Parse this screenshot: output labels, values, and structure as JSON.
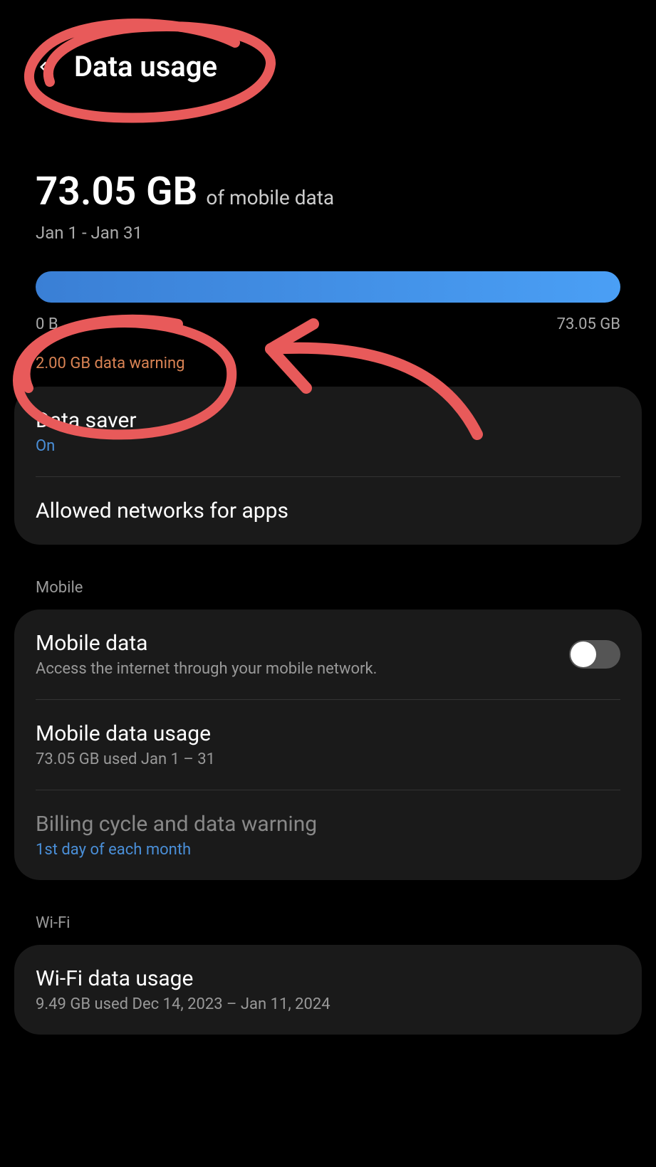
{
  "header": {
    "title": "Data usage"
  },
  "summary": {
    "usage_value": "73.05 GB",
    "usage_label": "of mobile data",
    "period": "Jan 1 - Jan 31",
    "bar_min": "0 B",
    "bar_max": "73.05 GB",
    "warning": "2.00 GB data warning"
  },
  "card1": {
    "data_saver_title": "Data saver",
    "data_saver_status": "On",
    "allowed_networks_title": "Allowed networks for apps"
  },
  "sections": {
    "mobile": "Mobile",
    "wifi": "Wi-Fi"
  },
  "mobile": {
    "mobile_data_title": "Mobile data",
    "mobile_data_sub": "Access the internet through your mobile network.",
    "usage_title": "Mobile data usage",
    "usage_sub": "73.05 GB used Jan 1 – 31",
    "billing_title": "Billing cycle and data warning",
    "billing_sub": "1st day of each month"
  },
  "wifi": {
    "usage_title": "Wi-Fi data usage",
    "usage_sub": "9.49 GB used Dec 14, 2023 – Jan 11, 2024"
  },
  "annotation": {
    "color": "#e85a5a"
  }
}
